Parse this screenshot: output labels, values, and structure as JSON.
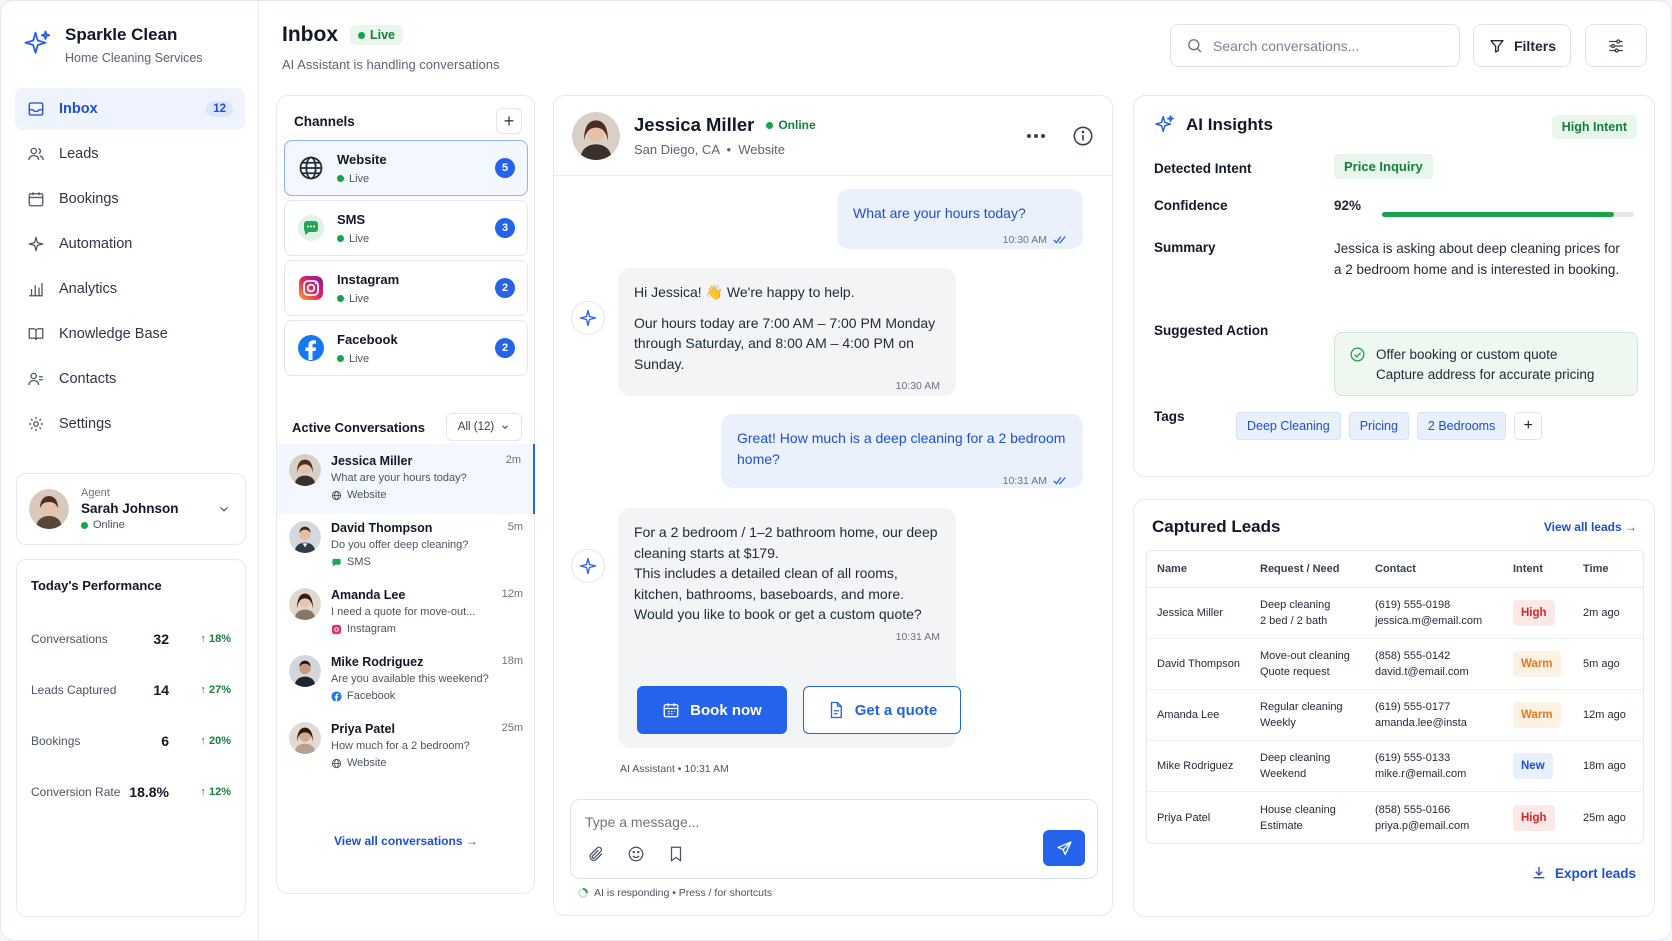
{
  "brand": {
    "name": "Sparkle Clean",
    "subtitle": "Home Cleaning Services"
  },
  "nav": [
    {
      "label": "Inbox",
      "icon": "inbox-icon",
      "count": "12",
      "active": true
    },
    {
      "label": "Leads",
      "icon": "users-icon"
    },
    {
      "label": "Bookings",
      "icon": "calendar-icon"
    },
    {
      "label": "Automation",
      "icon": "sparkle-icon"
    },
    {
      "label": "Analytics",
      "icon": "bar-chart-icon"
    },
    {
      "label": "Knowledge Base",
      "icon": "book-icon"
    },
    {
      "label": "Contacts",
      "icon": "contacts-icon"
    },
    {
      "label": "Settings",
      "icon": "gear-icon"
    }
  ],
  "agent": {
    "label": "Agent",
    "name": "Sarah Johnson",
    "status": "Online"
  },
  "performance": {
    "title": "Today's Performance",
    "rows": [
      {
        "label": "Conversations",
        "value": "32",
        "change": "↑ 18%"
      },
      {
        "label": "Leads Captured",
        "value": "14",
        "change": "↑ 27%"
      },
      {
        "label": "Bookings",
        "value": "6",
        "change": "↑ 20%"
      },
      {
        "label": "Conversion Rate",
        "value": "18.8%",
        "change": "↑ 12%"
      }
    ]
  },
  "header": {
    "title": "Inbox",
    "live": "Live",
    "subtitle": "AI Assistant is handling conversations"
  },
  "search": {
    "placeholder": "Search conversations..."
  },
  "filters_label": "Filters",
  "channels": {
    "title": "Channels",
    "items": [
      {
        "name": "Website",
        "status": "Live",
        "count": "5",
        "icon": "globe-icon"
      },
      {
        "name": "SMS",
        "status": "Live",
        "count": "3",
        "icon": "sms-icon"
      },
      {
        "name": "Instagram",
        "status": "Live",
        "count": "2",
        "icon": "instagram-icon"
      },
      {
        "name": "Facebook",
        "status": "Live",
        "count": "2",
        "icon": "facebook-icon"
      }
    ]
  },
  "active": {
    "title": "Active Conversations",
    "filter": "All (12)",
    "items": [
      {
        "name": "Jessica Miller",
        "time": "2m",
        "msg": "What are your hours today?",
        "channel": "Website"
      },
      {
        "name": "David Thompson",
        "time": "5m",
        "msg": "Do you offer deep cleaning?",
        "channel": "SMS"
      },
      {
        "name": "Amanda Lee",
        "time": "12m",
        "msg": "I need a quote for move-out...",
        "channel": "Instagram"
      },
      {
        "name": "Mike Rodriguez",
        "time": "18m",
        "msg": "Are you available this weekend?",
        "channel": "Facebook"
      },
      {
        "name": "Priya Patel",
        "time": "25m",
        "msg": "How much for a 2 bedroom?",
        "channel": "Website"
      }
    ],
    "view_all": "View all conversations →"
  },
  "chat": {
    "name": "Jessica Miller",
    "status": "Online",
    "location": "San Diego, CA  •  Website",
    "messages": [
      {
        "text": "What are your hours today?",
        "time": "10:30 AM"
      },
      {
        "line1": "Hi Jessica! 👋 We're happy to help.",
        "line2": "Our hours today are 7:00 AM – 7:00 PM Monday through Saturday, and 8:00 AM – 4:00 PM on Sunday.",
        "time": "10:30 AM"
      },
      {
        "text": "Great! How much is a deep cleaning for a 2 bedroom home?",
        "time": "10:31 AM"
      },
      {
        "line1": "For a 2 bedroom / 1–2 bathroom home, our deep cleaning starts at $179.",
        "line2": "This includes a detailed clean of all rooms, kitchen, bathrooms, baseboards, and more. Would you like to book or get a custom quote?",
        "time": "10:31 AM"
      }
    ],
    "book_label": "Book now",
    "quote_label": "Get a quote",
    "ai_meta": "AI Assistant • 10:31 AM",
    "composer_placeholder": "Type a message...",
    "responding": "AI is responding • Press / for shortcuts"
  },
  "insights": {
    "title": "AI Insights",
    "badge": "High Intent",
    "intent_label": "Detected Intent",
    "intent": "Price Inquiry",
    "confidence_label": "Confidence",
    "confidence": "92%",
    "confidence_fraction": 0.92,
    "summary_label": "Summary",
    "summary": "Jessica is asking about deep cleaning prices for a 2 bedroom home and is interested in booking.",
    "action_label": "Suggested Action",
    "action1": "Offer booking or custom quote",
    "action2": "Capture address for accurate pricing",
    "tags_label": "Tags",
    "tags": [
      "Deep Cleaning",
      "Pricing",
      "2 Bedrooms"
    ]
  },
  "leads": {
    "title": "Captured Leads",
    "view_all": "View all leads →",
    "columns": [
      "Name",
      "Request / Need",
      "Contact",
      "Intent",
      "Time"
    ],
    "rows": [
      {
        "name": "Jessica Miller",
        "req1": "Deep cleaning",
        "req2": "2 bed / 2 bath",
        "phone": "(619) 555-0198",
        "email": "jessica.m@email.com",
        "intent": "High",
        "time": "2m ago"
      },
      {
        "name": "David Thompson",
        "req1": "Move-out cleaning",
        "req2": "Quote request",
        "phone": "(858) 555-0142",
        "email": "david.t@email.com",
        "intent": "Warm",
        "time": "5m ago"
      },
      {
        "name": "Amanda Lee",
        "req1": "Regular cleaning",
        "req2": "Weekly",
        "phone": "(619) 555-0177",
        "email": "amanda.lee@insta",
        "intent": "Warm",
        "time": "12m ago"
      },
      {
        "name": "Mike Rodriguez",
        "req1": "Deep cleaning",
        "req2": "Weekend",
        "phone": "(619) 555-0133",
        "email": "mike.r@email.com",
        "intent": "New",
        "time": "18m ago"
      },
      {
        "name": "Priya Patel",
        "req1": "House cleaning",
        "req2": "Estimate",
        "phone": "(858) 555-0166",
        "email": "priya.p@email.com",
        "intent": "High",
        "time": "25m ago"
      }
    ],
    "export": "Export leads"
  },
  "colors": {
    "accent": "#2563eb",
    "success": "#16a34a",
    "high": "#dc2626",
    "warm": "#ea7a14"
  }
}
